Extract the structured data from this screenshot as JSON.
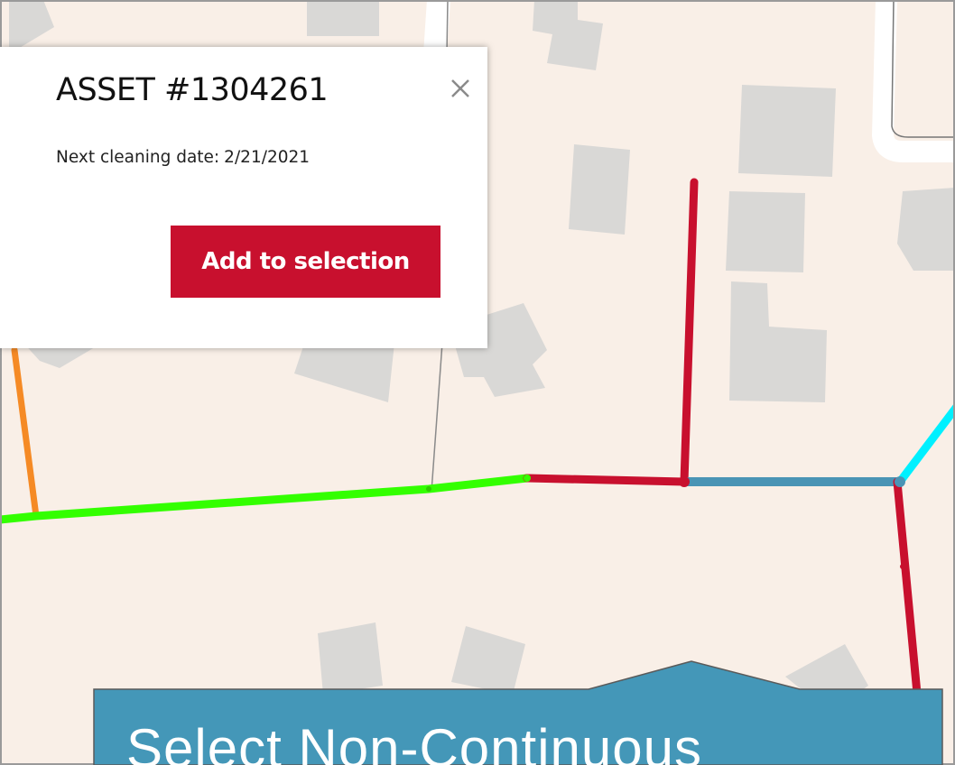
{
  "popup": {
    "title": "ASSET #1304261",
    "close_glyph": "×",
    "detail_label": "Next cleaning date:",
    "detail_value": "2/21/2021",
    "button_label": "Add to selection"
  },
  "callout": {
    "text": "Select Non-Continuous"
  },
  "colors": {
    "map_background": "#f9efe7",
    "building": "#d9d8d6",
    "button": "#c8102e",
    "callout": "#4497b8",
    "pipe_red": "#c8102e",
    "pipe_green": "#33ff00",
    "pipe_orange": "#f58a25",
    "pipe_steelblue": "#4a94b5",
    "pipe_cyan": "#00f0ff"
  },
  "icons": {
    "close": "close-icon"
  }
}
